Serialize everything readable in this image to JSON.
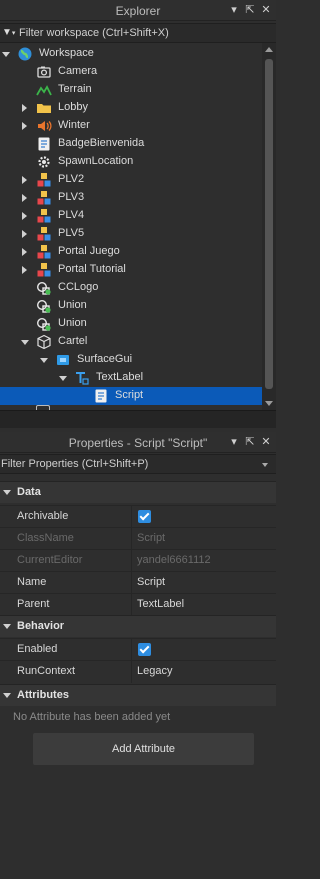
{
  "explorer": {
    "title": "Explorer",
    "filter_placeholder": "Filter workspace (Ctrl+Shift+X)",
    "items": [
      {
        "label": "Workspace",
        "icon": "globe-icon",
        "arrow": "expanded"
      },
      {
        "label": "Camera",
        "icon": "camera-icon",
        "arrow": ""
      },
      {
        "label": "Terrain",
        "icon": "terrain-icon",
        "arrow": ""
      },
      {
        "label": "Lobby",
        "icon": "folder-icon",
        "arrow": "collapsed"
      },
      {
        "label": "Winter",
        "icon": "sound-icon",
        "arrow": "collapsed"
      },
      {
        "label": "BadgeBienvenida",
        "icon": "script-icon",
        "arrow": ""
      },
      {
        "label": "SpawnLocation",
        "icon": "spawn-gear-icon",
        "arrow": ""
      },
      {
        "label": "PLV2",
        "icon": "model-icon",
        "arrow": "collapsed"
      },
      {
        "label": "PLV3",
        "icon": "model-icon",
        "arrow": "collapsed"
      },
      {
        "label": "PLV4",
        "icon": "model-icon",
        "arrow": "collapsed"
      },
      {
        "label": "PLV5",
        "icon": "model-icon",
        "arrow": "collapsed"
      },
      {
        "label": "Portal Juego",
        "icon": "model-icon",
        "arrow": "collapsed"
      },
      {
        "label": "Portal Tutorial",
        "icon": "model-icon",
        "arrow": "collapsed"
      },
      {
        "label": "CCLogo",
        "icon": "union-icon",
        "arrow": ""
      },
      {
        "label": "Union",
        "icon": "union-icon",
        "arrow": ""
      },
      {
        "label": "Union",
        "icon": "union-icon",
        "arrow": ""
      },
      {
        "label": "Cartel",
        "icon": "part-icon",
        "arrow": "expanded"
      },
      {
        "label": "SurfaceGui",
        "icon": "surfacegui-icon",
        "arrow": "expanded"
      },
      {
        "label": "TextLabel",
        "icon": "textlabel-icon",
        "arrow": "expanded"
      },
      {
        "label": "Script",
        "icon": "script-icon",
        "arrow": "",
        "selected": true
      }
    ]
  },
  "properties": {
    "title": "Properties - Script \"Script\"",
    "filter_placeholder": "Filter Properties (Ctrl+Shift+P)",
    "sections": {
      "data": "Data",
      "behavior": "Behavior",
      "attributes": "Attributes"
    },
    "rows": {
      "archivable": {
        "name": "Archivable",
        "checked": true
      },
      "classname": {
        "name": "ClassName",
        "value": "Script"
      },
      "currenteditor": {
        "name": "CurrentEditor",
        "value": "yandel6661112"
      },
      "name": {
        "name": "Name",
        "value": "Script"
      },
      "parent": {
        "name": "Parent",
        "value": "TextLabel"
      },
      "enabled": {
        "name": "Enabled",
        "checked": true
      },
      "runcontext": {
        "name": "RunContext",
        "value": "Legacy"
      }
    },
    "no_attributes": "No Attribute has been added yet",
    "add_attribute": "Add Attribute"
  },
  "colors": {
    "selection": "#0b5ab8",
    "checkbox": "#2e8de0",
    "folder": "#f2c34a",
    "sound": "#e8742c",
    "terrain": "#3bb54a"
  }
}
